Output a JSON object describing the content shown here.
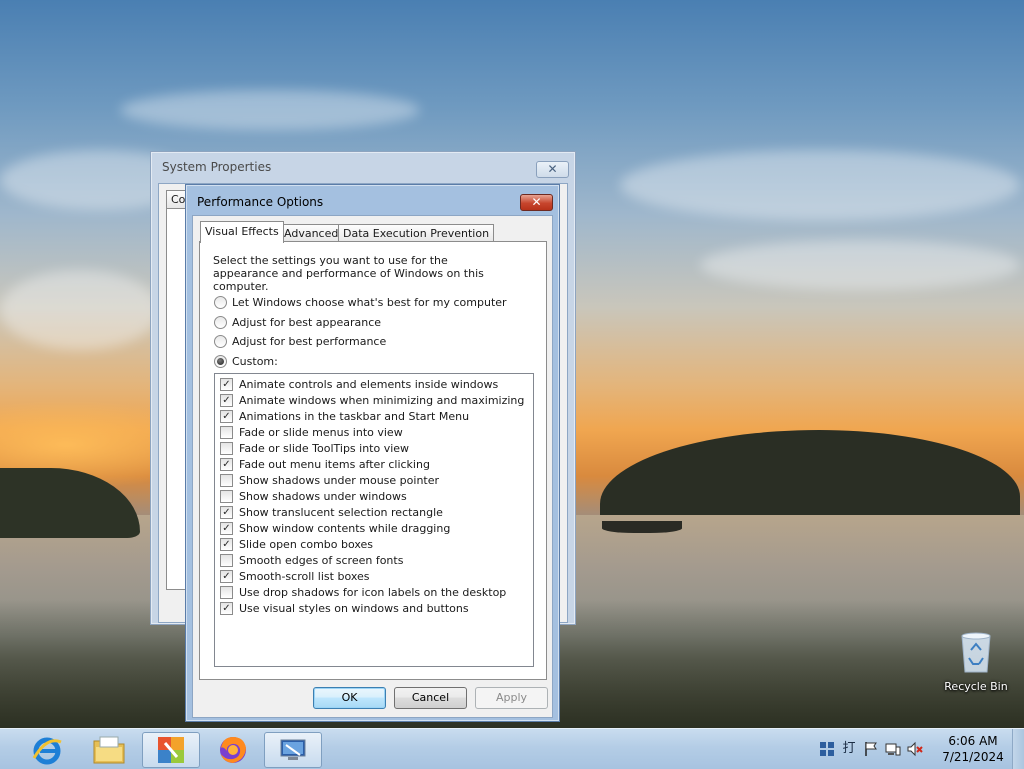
{
  "desktop": {
    "recycle_bin_label": "Recycle Bin"
  },
  "system_properties": {
    "title": "System Properties",
    "visible_tab_fragment": "Co",
    "close_symbol": "✕"
  },
  "performance_options": {
    "title": "Performance Options",
    "close_symbol": "✕",
    "tabs": [
      {
        "label": "Visual Effects",
        "active": true
      },
      {
        "label": "Advanced",
        "active": false
      },
      {
        "label": "Data Execution Prevention",
        "active": false
      }
    ],
    "description": "Select the settings you want to use for the appearance and performance of Windows on this computer.",
    "radio_options": [
      {
        "label": "Let Windows choose what's best for my computer",
        "checked": false
      },
      {
        "label": "Adjust for best appearance",
        "checked": false
      },
      {
        "label": "Adjust for best performance",
        "checked": false
      },
      {
        "label": "Custom:",
        "checked": true
      }
    ],
    "effects": [
      {
        "label": "Animate controls and elements inside windows",
        "checked": true
      },
      {
        "label": "Animate windows when minimizing and maximizing",
        "checked": true
      },
      {
        "label": "Animations in the taskbar and Start Menu",
        "checked": true
      },
      {
        "label": "Fade or slide menus into view",
        "checked": false
      },
      {
        "label": "Fade or slide ToolTips into view",
        "checked": false
      },
      {
        "label": "Fade out menu items after clicking",
        "checked": true
      },
      {
        "label": "Show shadows under mouse pointer",
        "checked": false
      },
      {
        "label": "Show shadows under windows",
        "checked": false
      },
      {
        "label": "Show translucent selection rectangle",
        "checked": true
      },
      {
        "label": "Show window contents while dragging",
        "checked": true
      },
      {
        "label": "Slide open combo boxes",
        "checked": true
      },
      {
        "label": "Smooth edges of screen fonts",
        "checked": false
      },
      {
        "label": "Smooth-scroll list boxes",
        "checked": true
      },
      {
        "label": "Use drop shadows for icon labels on the desktop",
        "checked": false
      },
      {
        "label": "Use visual styles on windows and buttons",
        "checked": true
      }
    ],
    "buttons": {
      "ok": "OK",
      "cancel": "Cancel",
      "apply": "Apply"
    }
  },
  "taskbar": {
    "items": [
      {
        "name": "internet-explorer-icon"
      },
      {
        "name": "file-explorer-icon"
      },
      {
        "name": "winrar-icon"
      },
      {
        "name": "firefox-icon"
      },
      {
        "name": "system-properties-app-icon"
      }
    ],
    "tray": {
      "time": "6:06 AM",
      "date": "7/21/2024",
      "icons": [
        "tray-grid-icon",
        "ime-icon",
        "action-center-flag-icon",
        "network-icon",
        "volume-muted-icon"
      ],
      "ime_text": "打"
    }
  }
}
